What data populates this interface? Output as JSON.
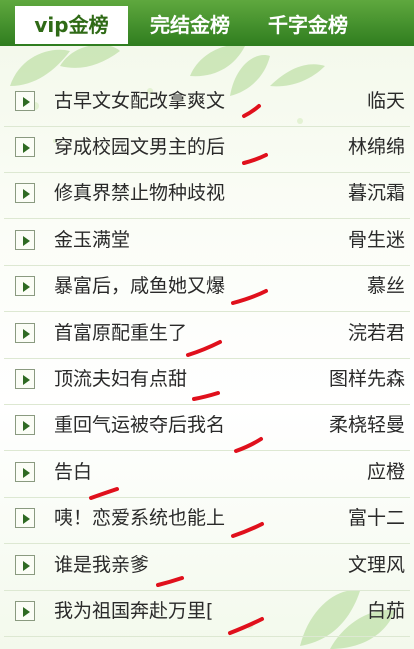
{
  "tabs": [
    {
      "label": "vip金榜",
      "active": true
    },
    {
      "label": "完结金榜",
      "active": false
    },
    {
      "label": "千字金榜",
      "active": false
    }
  ],
  "rows": [
    {
      "title": "古早文女配改拿爽文",
      "author": "临天"
    },
    {
      "title": "穿成校园文男主的后",
      "author": "林绵绵"
    },
    {
      "title": "修真界禁止物种歧视",
      "author": "暮沉霜"
    },
    {
      "title": "金玉满堂",
      "author": "骨生迷"
    },
    {
      "title": "暴富后，咸鱼她又爆",
      "author": "慕丝"
    },
    {
      "title": "首富原配重生了",
      "author": "浣若君"
    },
    {
      "title": "顶流夫妇有点甜",
      "author": "图样先森"
    },
    {
      "title": "重回气运被夺后我名",
      "author": "柔桡轻曼"
    },
    {
      "title": "告白",
      "author": "应橙"
    },
    {
      "title": "咦！恋爱系统也能上",
      "author": "富十二"
    },
    {
      "title": "谁是我亲爹",
      "author": "文理风"
    },
    {
      "title": "我为祖国奔赴万里[",
      "author": "白茄"
    }
  ],
  "icons": {
    "row": "play-arrow-icon"
  },
  "colors": {
    "tab_bar": "#3c8a26",
    "active_tab_text": "#2f6a16",
    "annotation": "#e0101c"
  }
}
